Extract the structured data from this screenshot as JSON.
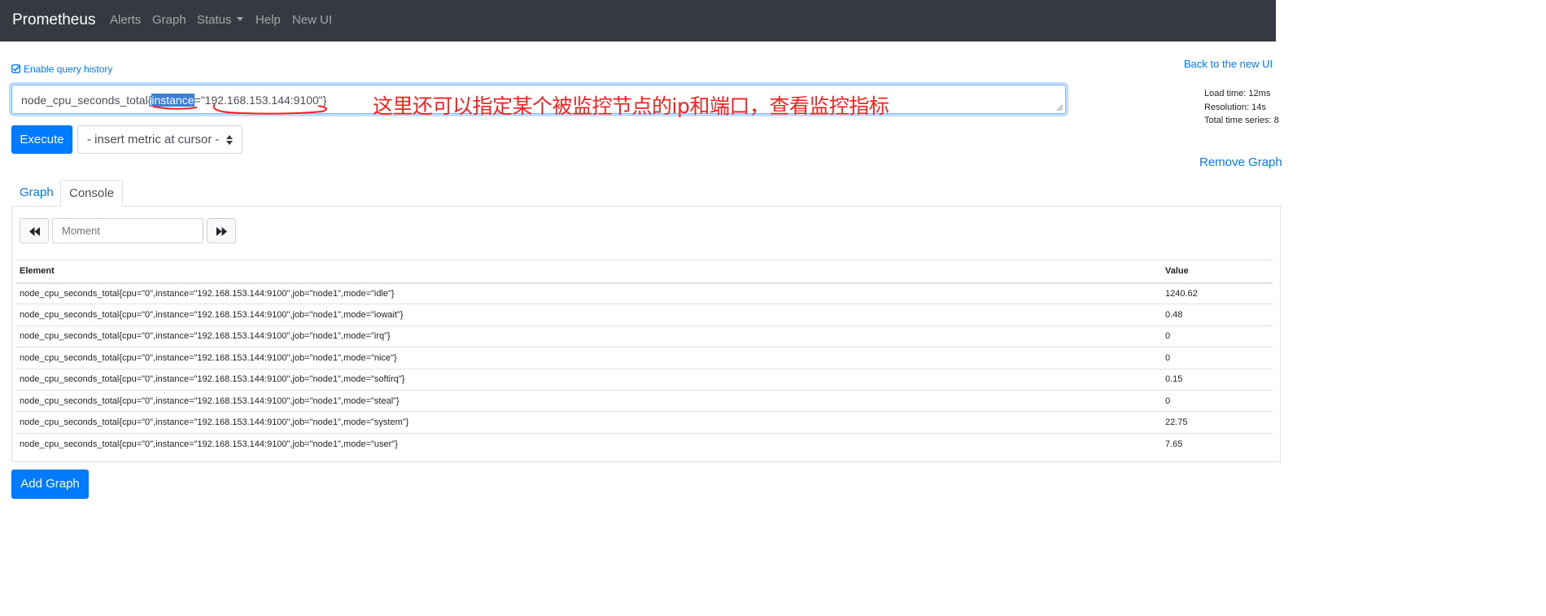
{
  "navbar": {
    "brand": "Prometheus",
    "links": [
      "Alerts",
      "Graph",
      "Status",
      "Help",
      "New UI"
    ]
  },
  "options": {
    "history_label": "Enable query history",
    "back_link": "Back to the new UI"
  },
  "query": {
    "prefix": "node_cpu_seconds_total{",
    "selected": "instance",
    "suffix": "=\"192.168.153.144:9100\"}",
    "annotation": "这里还可以指定某个被监控节点的ip和端口，查看监控指标"
  },
  "stats": {
    "load_time": "Load time: 12ms",
    "resolution": "Resolution: 14s",
    "total_series": "Total time series: 8"
  },
  "controls": {
    "execute": "Execute",
    "metric_select": "- insert metric at cursor -",
    "remove_graph": "Remove Graph",
    "add_graph": "Add Graph"
  },
  "tabs": {
    "graph": "Graph",
    "console": "Console"
  },
  "console": {
    "moment_placeholder": "Moment"
  },
  "table": {
    "headers": {
      "element": "Element",
      "value": "Value"
    },
    "rows": [
      {
        "element": "node_cpu_seconds_total{cpu=\"0\",instance=\"192.168.153.144:9100\",job=\"node1\",mode=\"idle\"}",
        "value": "1240.62"
      },
      {
        "element": "node_cpu_seconds_total{cpu=\"0\",instance=\"192.168.153.144:9100\",job=\"node1\",mode=\"iowait\"}",
        "value": "0.48"
      },
      {
        "element": "node_cpu_seconds_total{cpu=\"0\",instance=\"192.168.153.144:9100\",job=\"node1\",mode=\"irq\"}",
        "value": "0"
      },
      {
        "element": "node_cpu_seconds_total{cpu=\"0\",instance=\"192.168.153.144:9100\",job=\"node1\",mode=\"nice\"}",
        "value": "0"
      },
      {
        "element": "node_cpu_seconds_total{cpu=\"0\",instance=\"192.168.153.144:9100\",job=\"node1\",mode=\"softirq\"}",
        "value": "0.15"
      },
      {
        "element": "node_cpu_seconds_total{cpu=\"0\",instance=\"192.168.153.144:9100\",job=\"node1\",mode=\"steal\"}",
        "value": "0"
      },
      {
        "element": "node_cpu_seconds_total{cpu=\"0\",instance=\"192.168.153.144:9100\",job=\"node1\",mode=\"system\"}",
        "value": "22.75"
      },
      {
        "element": "node_cpu_seconds_total{cpu=\"0\",instance=\"192.168.153.144:9100\",job=\"node1\",mode=\"user\"}",
        "value": "7.65"
      }
    ]
  },
  "icons": {
    "history_check": "checkbox-checked-icon",
    "time_back": "backward-icon",
    "time_forward": "forward-icon",
    "select_arrows": "sort-arrows-icon"
  },
  "colors": {
    "navbar_bg": "#343a40",
    "primary": "#007bff",
    "annotation": "#ff1f1f",
    "selection": "#3b7fd6"
  }
}
